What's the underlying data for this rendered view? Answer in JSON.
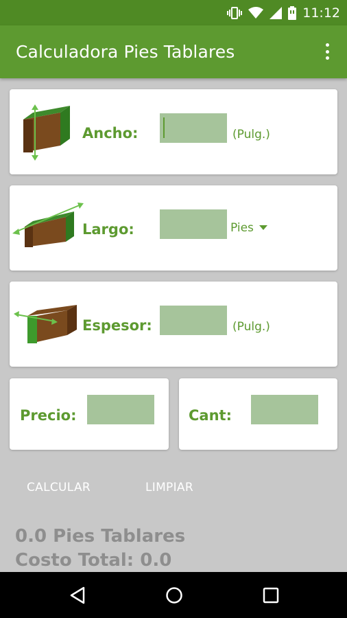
{
  "status_bar": {
    "time": "11:12"
  },
  "app_bar": {
    "title": "Calculadora Pies Tablares"
  },
  "inputs": {
    "ancho": {
      "label": "Ancho:",
      "value": "",
      "unit": "(Pulg.)"
    },
    "largo": {
      "label": "Largo:",
      "value": "",
      "unit": "Pies"
    },
    "espesor": {
      "label": "Espesor:",
      "value": "",
      "unit": "(Pulg.)"
    },
    "precio": {
      "label": "Precio:",
      "value": ""
    },
    "cantidad": {
      "label": "Cant:",
      "value": ""
    }
  },
  "buttons": {
    "calcular": "CALCULAR",
    "limpiar": "LIMPIAR"
  },
  "results": {
    "pies_tablares": "0.0 Pies Tablares",
    "costo_total": "Costo Total: 0.0"
  },
  "colors": {
    "primary": "#5d9a30",
    "primary_dark": "#4f8a24",
    "field": "#a6c49b",
    "background": "#c8c8c8",
    "result_text": "#8e8e8e"
  }
}
